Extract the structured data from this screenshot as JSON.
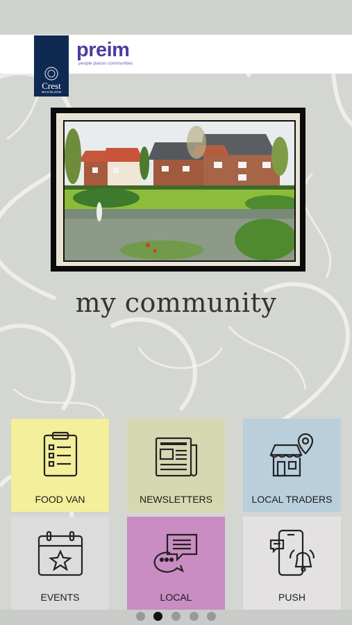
{
  "brand": {
    "crest_name": "Crest",
    "crest_sub": "NICHOLSON",
    "preim_name": "preim",
    "preim_tagline": "people places communities"
  },
  "hero": {
    "title": "my community"
  },
  "tiles": [
    {
      "label": "FOOD VAN",
      "icon": "clipboard-list-icon",
      "color": "#f3ef9a"
    },
    {
      "label": "NEWSLETTERS",
      "icon": "newspaper-icon",
      "color": "#d6d8b2"
    },
    {
      "label": "LOCAL TRADERS",
      "icon": "shop-location-icon",
      "color": "#b9cfdc"
    },
    {
      "label": "EVENTS",
      "icon": "calendar-star-icon",
      "color": "#dcdcdc"
    },
    {
      "label": "LOCAL",
      "icon": "chat-bubbles-icon",
      "color": "#c98cc3"
    },
    {
      "label": "PUSH",
      "icon": "phone-bell-icon",
      "color": "#e3e1e2"
    }
  ],
  "pagination": {
    "pages": 5,
    "active_page": 2
  }
}
